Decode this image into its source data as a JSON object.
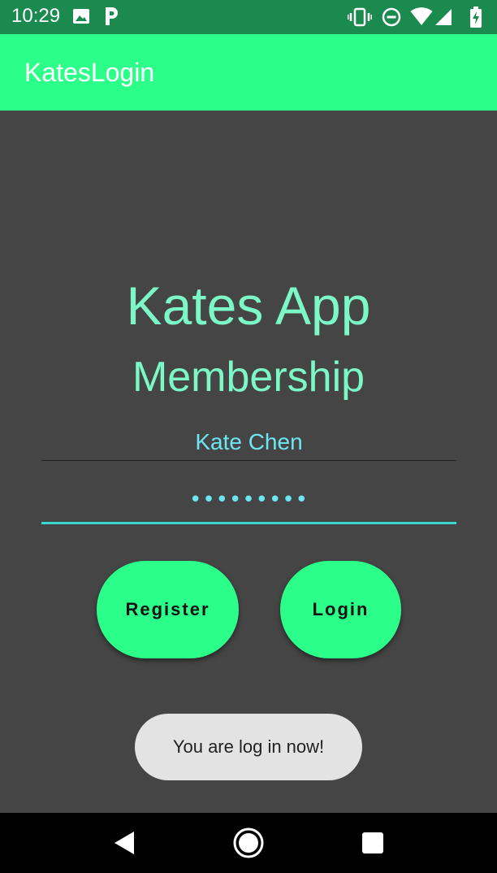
{
  "status_bar": {
    "time": "10:29",
    "icons": [
      "image-icon",
      "parking-icon",
      "vibrate-icon",
      "do-not-disturb-icon",
      "wifi-icon",
      "signal-icon",
      "battery-charging-icon"
    ]
  },
  "app_bar": {
    "title": "KatesLogin"
  },
  "main": {
    "heading": "Kates App",
    "subheading": "Membership",
    "username_value": "Kate Chen",
    "password_value": "•••••••••",
    "register_label": "Register",
    "login_label": "Login"
  },
  "toast": {
    "message": "You are log in now!"
  },
  "nav_bar": {
    "buttons": [
      "back-icon",
      "home-icon",
      "recents-icon"
    ]
  },
  "colors": {
    "status_bar": "#1b8a4e",
    "accent": "#2bff8a",
    "heading_text": "#7cf7c7",
    "field_text": "#6ee6f2",
    "background": "#454545"
  }
}
